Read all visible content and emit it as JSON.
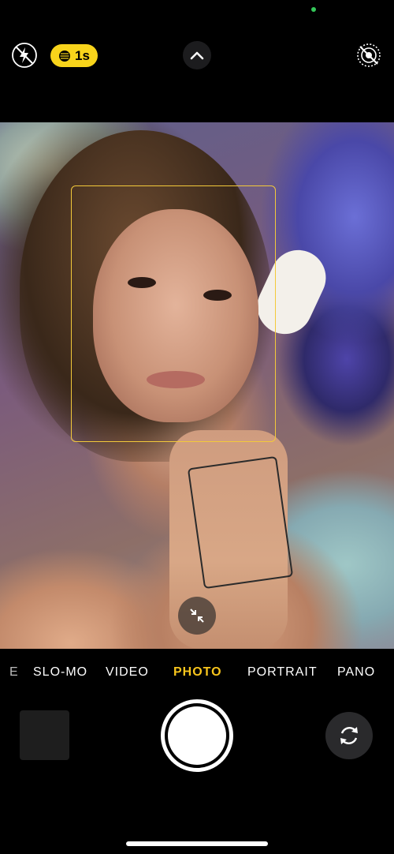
{
  "colors": {
    "accent": "#f8c51c",
    "timer_pill": "#f8d41b",
    "status_dot": "#34c759",
    "background": "#000000"
  },
  "top_bar": {
    "flash_icon": "flash-off-icon",
    "timer_label": "1s",
    "chevron_icon": "chevron-up-icon",
    "live_photo_icon": "live-photo-off-icon"
  },
  "viewfinder": {
    "focus_box_color": "#f3c93a",
    "collapse_icon": "collapse-arrows-icon"
  },
  "modes": {
    "clipped_left": "E",
    "items": [
      "SLO-MO",
      "VIDEO",
      "PHOTO",
      "PORTRAIT",
      "PANO"
    ],
    "active": "PHOTO"
  },
  "bottom_bar": {
    "thumbnail_icon": "last-photo-thumbnail",
    "shutter_icon": "shutter-button",
    "flip_icon": "camera-flip-icon"
  }
}
